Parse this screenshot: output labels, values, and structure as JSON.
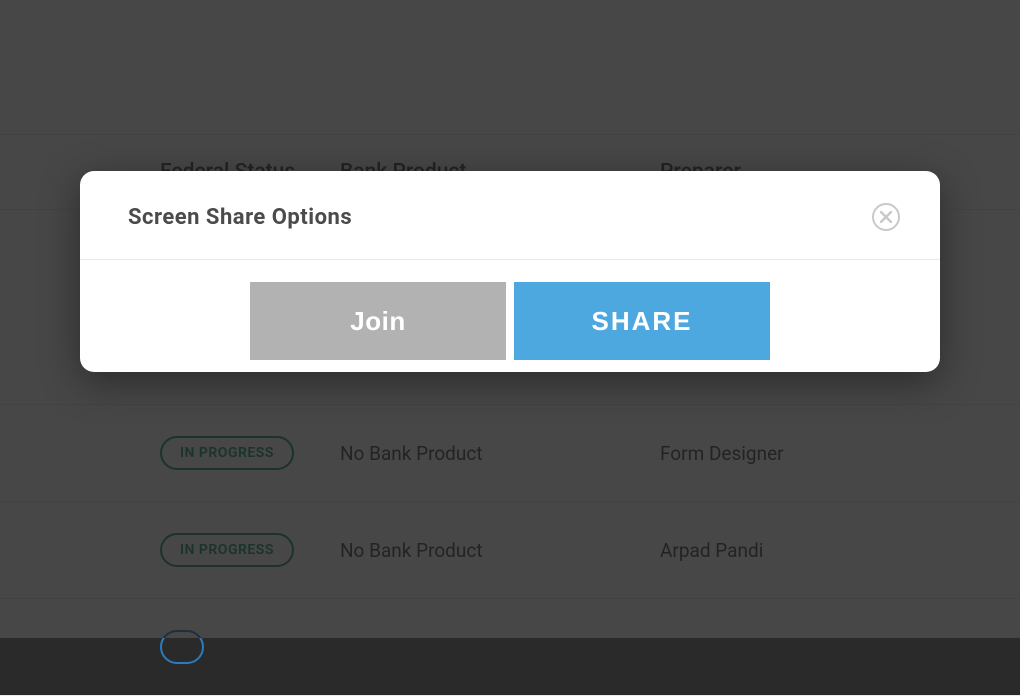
{
  "table": {
    "headers": {
      "status": "Federal Status",
      "bank": "Bank Product",
      "preparer": "Preparer"
    },
    "rows": [
      {
        "status": "IN PROGRESS",
        "bank": "No Bank Product",
        "preparer": "Form Designer"
      },
      {
        "status": "IN PROGRESS",
        "bank": "No Bank Product",
        "preparer": "Arpad Pandi"
      }
    ]
  },
  "modal": {
    "title": "Screen Share Options",
    "join_label": "Join",
    "share_label": "SHARE"
  }
}
